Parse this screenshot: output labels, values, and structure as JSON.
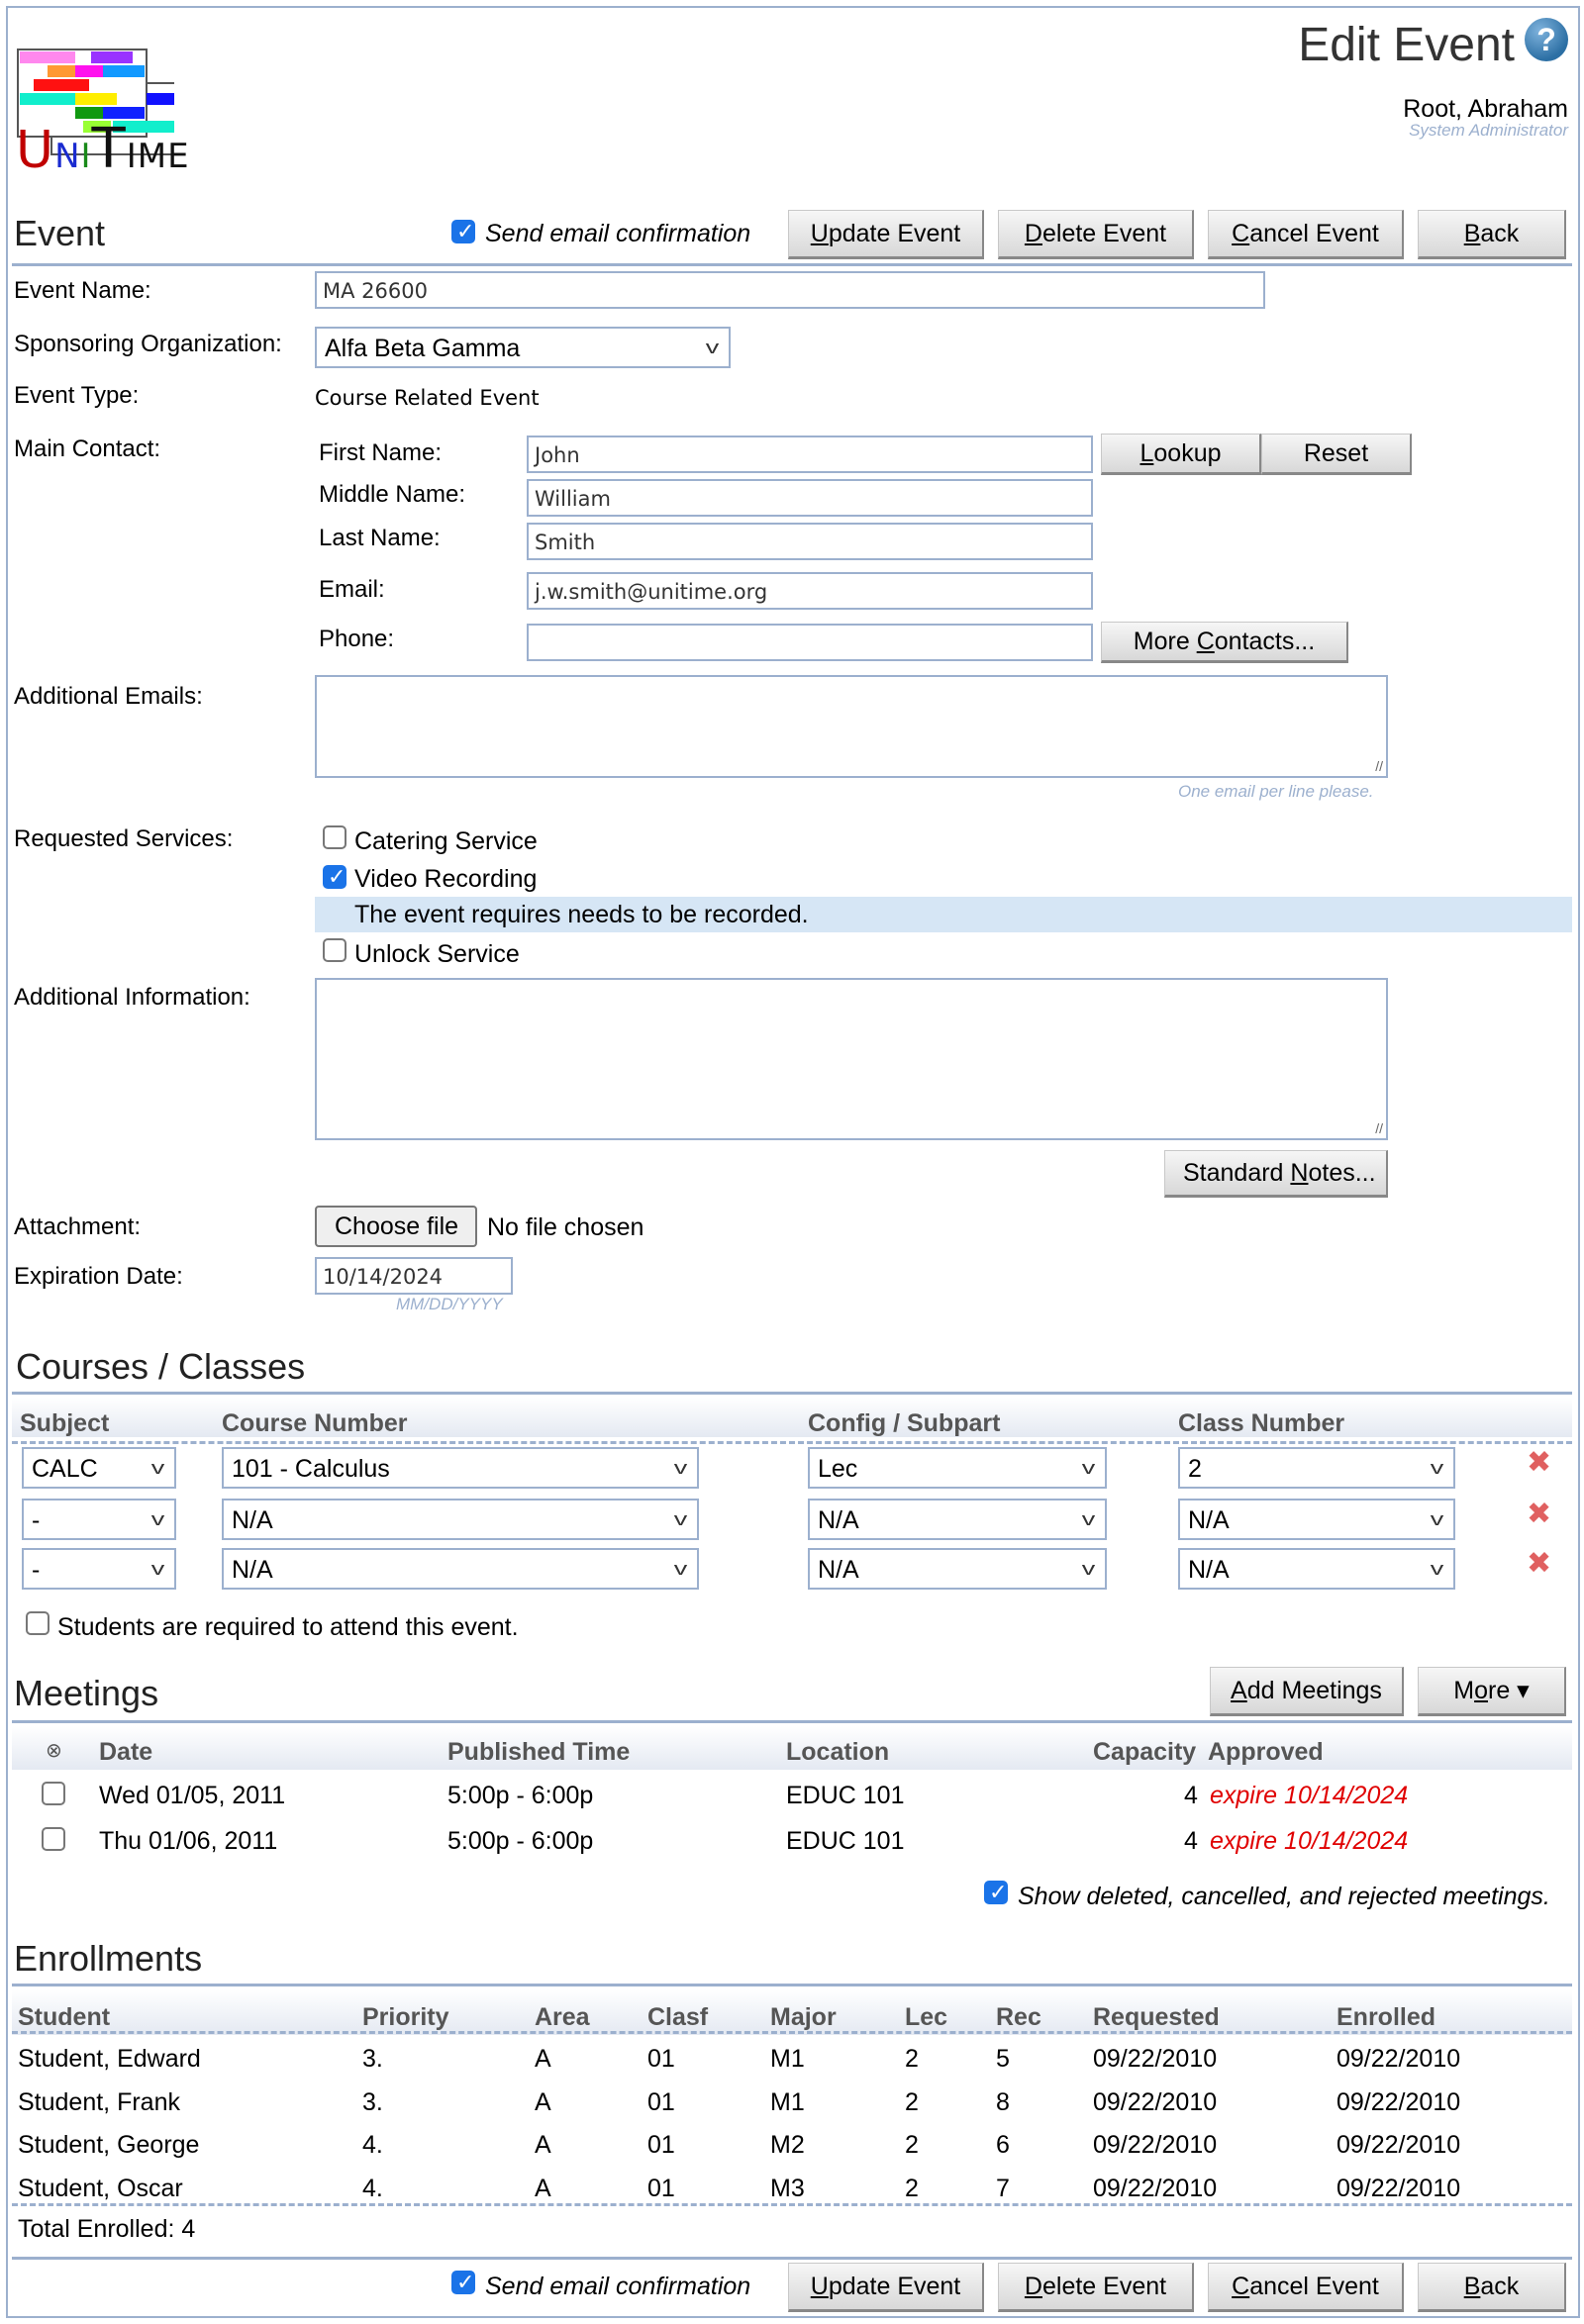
{
  "header": {
    "logo_text": "UniTime",
    "page_title": "Edit Event",
    "help_icon": "question-circle-icon",
    "user_name": "Root, Abraham",
    "user_role": "System Administrator"
  },
  "toolbar": {
    "send_email_label": "Send email confirmation",
    "send_email_checked": true,
    "update_label_u": "U",
    "update_label_rest": "pdate Event",
    "delete_label_u": "D",
    "delete_label_rest": "elete Event",
    "cancel_label_u": "C",
    "cancel_label_rest": "ancel Event",
    "back_label_u": "B",
    "back_label_rest": "ack"
  },
  "event": {
    "section_title": "Event",
    "name_label": "Event Name:",
    "name_value": "MA 26600",
    "sponsor_label": "Sponsoring Organization:",
    "sponsor_value": "Alfa Beta Gamma",
    "type_label": "Event Type:",
    "type_value": "Course Related Event",
    "main_contact_label": "Main Contact:",
    "first_name_label": "First Name:",
    "first_name_value": "John",
    "middle_name_label": "Middle Name:",
    "middle_name_value": "William",
    "last_name_label": "Last Name:",
    "last_name_value": "Smith",
    "email_label": "Email:",
    "email_value": "j.w.smith@unitime.org",
    "phone_label": "Phone:",
    "phone_value": "",
    "lookup_u": "L",
    "lookup_rest": "ookup",
    "reset_label": "Reset",
    "more_contacts_pre": "More ",
    "more_contacts_u": "C",
    "more_contacts_rest": "ontacts...",
    "additional_emails_label": "Additional Emails:",
    "additional_emails_value": "",
    "additional_emails_hint": "One email per line please.",
    "services_label": "Requested Services:",
    "services": [
      {
        "label": "Catering Service",
        "checked": false
      },
      {
        "label": "Video Recording",
        "checked": true
      },
      {
        "label": "Unlock Service",
        "checked": false
      }
    ],
    "video_note": "The event requires needs to be recorded.",
    "additional_info_label": "Additional Information:",
    "additional_info_value": "",
    "standard_notes_pre": "Standard ",
    "standard_notes_u": "N",
    "standard_notes_rest": "otes...",
    "attachment_label": "Attachment:",
    "choose_file_label": "Choose file",
    "no_file_label": "No file chosen",
    "expiration_label": "Expiration Date:",
    "expiration_value": "10/14/2024",
    "expiration_hint": "MM/DD/YYYY"
  },
  "courses": {
    "section_title": "Courses / Classes",
    "headers": [
      "Subject",
      "Course Number",
      "Config / Subpart",
      "Class Number"
    ],
    "rows": [
      {
        "subject": "CALC",
        "course": "101 - Calculus",
        "subpart": "Lec",
        "class": "2"
      },
      {
        "subject": "-",
        "course": "N/A",
        "subpart": "N/A",
        "class": "N/A"
      },
      {
        "subject": "-",
        "course": "N/A",
        "subpart": "N/A",
        "class": "N/A"
      }
    ],
    "students_required_label": "Students are required to attend this event.",
    "students_required_checked": false
  },
  "meetings": {
    "section_title": "Meetings",
    "add_meetings_u": "A",
    "add_meetings_rest": "dd Meetings",
    "more_pre": "M",
    "more_u": "o",
    "more_rest": "re ▾",
    "headers": [
      "Date",
      "Published Time",
      "Location",
      "Capacity",
      "Approved"
    ],
    "rows": [
      {
        "date": "Wed 01/05, 2011",
        "time": "5:00p - 6:00p",
        "location": "EDUC 101",
        "capacity": "4",
        "approved": "expire 10/14/2024"
      },
      {
        "date": "Thu 01/06, 2011",
        "time": "5:00p - 6:00p",
        "location": "EDUC 101",
        "capacity": "4",
        "approved": "expire 10/14/2024"
      }
    ],
    "show_deleted_label": "Show deleted, cancelled, and rejected meetings.",
    "show_deleted_checked": true
  },
  "enrollments": {
    "section_title": "Enrollments",
    "headers": [
      "Student",
      "Priority",
      "Area",
      "Clasf",
      "Major",
      "Lec",
      "Rec",
      "Requested",
      "Enrolled"
    ],
    "rows": [
      [
        "Student, Edward",
        "3.",
        "A",
        "01",
        "M1",
        "2",
        "5",
        "09/22/2010",
        "09/22/2010"
      ],
      [
        "Student, Frank",
        "3.",
        "A",
        "01",
        "M1",
        "2",
        "8",
        "09/22/2010",
        "09/22/2010"
      ],
      [
        "Student, George",
        "4.",
        "A",
        "01",
        "M2",
        "2",
        "6",
        "09/22/2010",
        "09/22/2010"
      ],
      [
        "Student, Oscar",
        "4.",
        "A",
        "01",
        "M3",
        "2",
        "7",
        "09/22/2010",
        "09/22/2010"
      ]
    ],
    "total_label": "Total Enrolled: 4"
  },
  "colors": {
    "accent_border": "#9cb0ce",
    "expire_red": "#e00000",
    "checkbox_blue": "#1a73e8",
    "note_bg": "#d6e6f5"
  }
}
